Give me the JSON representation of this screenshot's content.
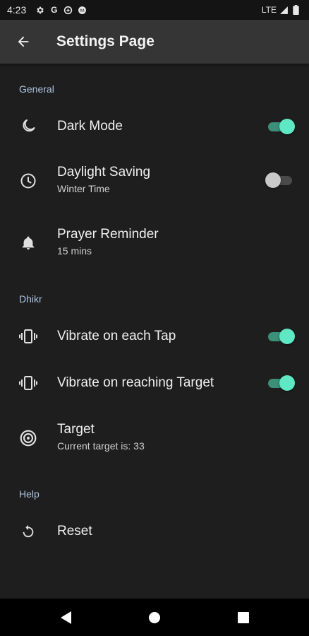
{
  "status_bar": {
    "time": "4:23",
    "network": "LTE",
    "icons": [
      "gear-icon",
      "google-icon",
      "data-saver-icon",
      "android-icon",
      "signal-icon",
      "battery-icon"
    ]
  },
  "app_bar": {
    "title": "Settings Page",
    "back_icon": "arrow-left-icon"
  },
  "sections": {
    "general": {
      "header": "General",
      "dark_mode": {
        "title": "Dark Mode",
        "icon": "moon-icon",
        "enabled": true
      },
      "daylight_saving": {
        "title": "Daylight Saving",
        "subtitle": "Winter Time",
        "icon": "clock-icon",
        "enabled": false
      },
      "prayer_reminder": {
        "title": "Prayer Reminder",
        "subtitle": "15 mins",
        "icon": "bell-icon"
      }
    },
    "dhikr": {
      "header": "Dhikr",
      "vibrate_tap": {
        "title": "Vibrate on each Tap",
        "icon": "vibrate-icon",
        "enabled": true
      },
      "vibrate_target": {
        "title": "Vibrate on reaching Target",
        "icon": "vibrate-icon",
        "enabled": true
      },
      "target": {
        "title": "Target",
        "subtitle": "Current target is: 33",
        "icon": "target-icon"
      }
    },
    "help": {
      "header": "Help",
      "reset": {
        "title": "Reset",
        "icon": "reset-icon"
      }
    }
  },
  "nav_bar": {
    "icons": [
      "back-triangle-icon",
      "home-circle-icon",
      "recents-square-icon"
    ]
  },
  "colors": {
    "background": "#1e1e1e",
    "app_bar": "#353535",
    "section_header": "#aac4e0",
    "toggle_on_thumb": "#5fe8c4",
    "toggle_on_track": "#3c8f78"
  }
}
